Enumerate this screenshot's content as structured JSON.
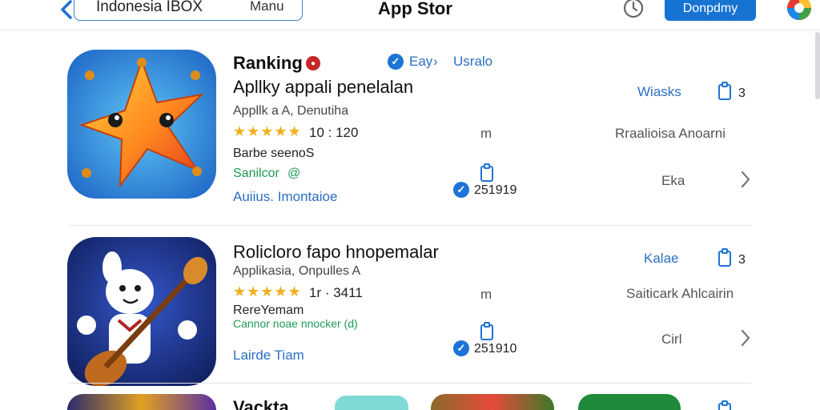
{
  "header": {
    "search_text": "Indonesia IBOX",
    "search_menu": "Manu",
    "title": "App Stor",
    "action_button": "Donpdmy"
  },
  "apps": [
    {
      "heading": "Ranking",
      "badge_label": "Eay",
      "badge_link": "Usralo",
      "name": "Apllky appali penelalan",
      "developer": "Appllk a A, Denutiha",
      "rating": "10 : 120",
      "stars": "★★★★★",
      "category": "Barbe seenoS",
      "tag": "Sanilcor",
      "tag_symbol": "@",
      "link": "Auiius. Imontaioe",
      "mid_label": "m",
      "count": "251919",
      "action_label": "Wiasks",
      "action_count": "3",
      "right_text": "Rraalioisa Anoarni",
      "right_action": "Eka",
      "icon_name": "star-mascot"
    },
    {
      "heading": "",
      "badge_label": "",
      "badge_link": "",
      "name": "Rolicloro fapo hnopemalar",
      "developer": "Applikasia, Onpulles A",
      "rating": "1r · 3411",
      "stars": "★★★★★",
      "category": "RereYemam",
      "tag": "Cannor noae nnocker (d)",
      "tag_symbol": "",
      "link": "Lairde Tiam",
      "mid_label": "m",
      "count": "251910",
      "action_label": "Kalae",
      "action_count": "3",
      "right_text": "Saiticark Ahlcairin",
      "right_action": "Cirl",
      "icon_name": "guitar-mascot"
    }
  ],
  "partial_row": {
    "name": "Vackta"
  },
  "colors": {
    "accent": "#1673d2",
    "star": "#f2b01e",
    "link_blue": "#2a6fc3",
    "green": "#1e9a55"
  }
}
